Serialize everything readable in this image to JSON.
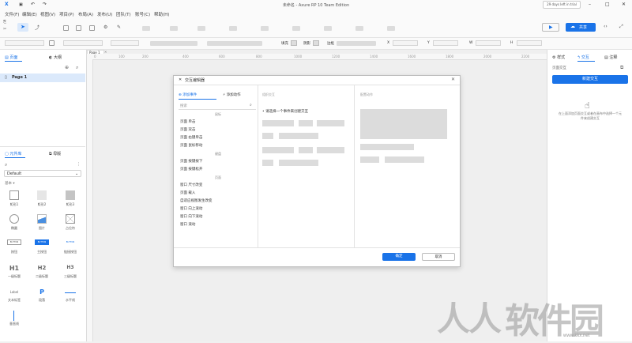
{
  "window": {
    "title": "未命名 - Axure RP 10 Team Edition",
    "trial_badge": "29 days left in trial",
    "logo": "X"
  },
  "menu": [
    "文件(F)",
    "编辑(E)",
    "视图(V)",
    "项目(P)",
    "布局(A)",
    "发布(U)",
    "团队(T)",
    "账号(C)",
    "帮助(H)"
  ],
  "toolbar": {
    "share_label": "共享",
    "zoom_label": "100%",
    "format_labels": [
      "填充",
      "阴影",
      "边框"
    ],
    "position_labels": [
      "X",
      "Y",
      "W",
      "H"
    ]
  },
  "left_panel": {
    "tabs": [
      "页面",
      "大纲"
    ],
    "active_tab": "页面",
    "pages": [
      "Page 1"
    ],
    "library_tabs": [
      "元件库",
      "母版"
    ],
    "library_select": "Default",
    "library_group": "基本 ▾",
    "widgets": [
      "矩形1",
      "矩形2",
      "矩形3",
      "椭圆",
      "图片",
      "占位符",
      "按钮",
      "主按钮",
      "链接按钮",
      "一级标题",
      "二级标题",
      "三级标题",
      "文本标签",
      "段落",
      "水平线",
      "垂直线"
    ],
    "widget_glyphs": {
      "h1": "H1",
      "h2": "H2",
      "h3": "H3",
      "label": "Label",
      "paragraph": "P",
      "button": "BUTTON",
      "primary": "BUTTON",
      "link": "BUTTON"
    }
  },
  "canvas": {
    "page_tab": "Page 1",
    "ruler_ticks": [
      "0",
      "100",
      "200",
      "400",
      "600",
      "800",
      "1000",
      "1200",
      "1400",
      "1600",
      "1800",
      "2000",
      "2200"
    ]
  },
  "right_panel": {
    "tabs": [
      "样式",
      "交互",
      "注释"
    ],
    "active_tab": "交互",
    "page_interactions_label": "页面交互",
    "new_interaction_button": "新建交互",
    "hint": "在上面添加页面交互或者在画布中选择一个元件来创建交互"
  },
  "dialog": {
    "title": "交互编辑器",
    "tab_add_event": "添加事件",
    "tab_add_action": "添加动作",
    "search_placeholder": "搜索",
    "section_mouse": "鼠标",
    "mouse_events": [
      "页面 单击",
      "页面 双击",
      "页面 右键单击",
      "页面 鼠标移动"
    ],
    "section_keyboard": "键盘",
    "keyboard_events": [
      "页面 按键按下",
      "页面 按键松开"
    ],
    "section_page": "页面",
    "page_events": [
      "窗口 尺寸改变",
      "页面 载入",
      "自适应视图发生改变",
      "窗口 向上滚动",
      "窗口 向下滚动",
      "窗口 滚动"
    ],
    "organize_header": "组织交互",
    "organize_hint": "请选择一个事件来创建交互",
    "configure_header": "配置动作",
    "ok_button": "确定",
    "cancel_button": "取消"
  },
  "watermark": {
    "text": "软件园",
    "url": "www.kkx.net"
  },
  "colors": {
    "accent": "#1a73e8",
    "active_page_bg": "#dbe9fb",
    "canvas_bg": "#efefef"
  }
}
